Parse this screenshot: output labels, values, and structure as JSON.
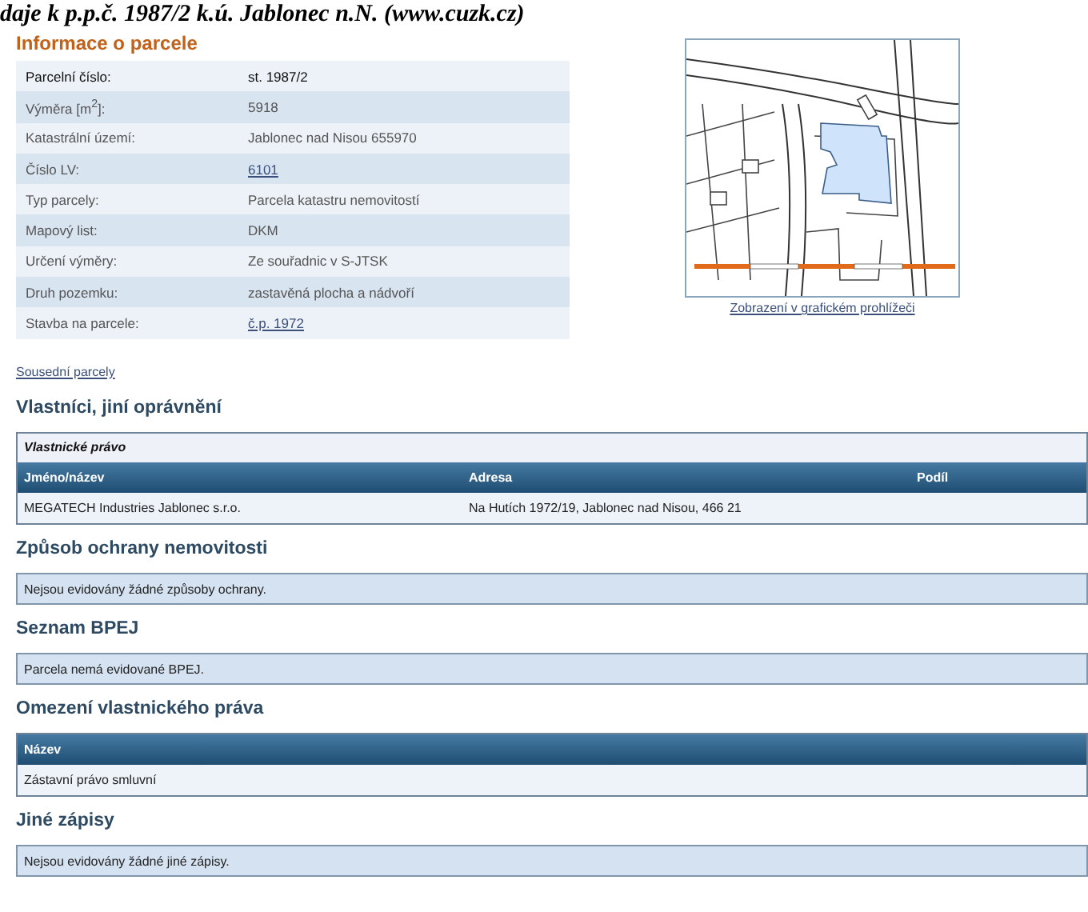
{
  "caption": "daje k p.p.č. 1987/2 k.ú. Jablonec n.N. (www.cuzk.cz)",
  "info": {
    "title": "Informace o parcele",
    "rows": [
      {
        "label": "Parcelní číslo:",
        "value": "st. 1987/2",
        "kind": "bold"
      },
      {
        "label": "Výměra [m$^{2}$]:",
        "value": "5918",
        "kind": "text"
      },
      {
        "label": "Katastrální území:",
        "value": "Jablonec nad Nisou 655970",
        "kind": "text"
      },
      {
        "label": "Číslo LV:",
        "value": "6101",
        "kind": "link"
      },
      {
        "label": "Typ parcely:",
        "value": "Parcela katastru nemovitostí",
        "kind": "text"
      },
      {
        "label": "Mapový list:",
        "value": "DKM",
        "kind": "text"
      },
      {
        "label": "Určení výměry:",
        "value": "Ze souřadnic v S-JTSK",
        "kind": "text"
      },
      {
        "label": "Druh pozemku:",
        "value": "zastavěná plocha a nádvoří",
        "kind": "text"
      },
      {
        "label": "Stavba na parcele:",
        "value": "č.p. 1972",
        "kind": "link"
      }
    ]
  },
  "map": {
    "kind": "picture",
    "link": "Zobrazení v grafickém prohlížeči"
  },
  "neighbors_link": "Sousední parcely",
  "sections": [
    {
      "title": "Vlastníci, jiní oprávnění",
      "kind": "table",
      "caption": "Vlastnické právo",
      "columns": [
        "Jméno/název",
        "Adresa",
        "Podíl"
      ],
      "rows": [
        [
          "MEGATECH Industries Jablonec s.r.o.",
          "Na Hutích 1972/19, Jablonec nad Nisou, 466 21"
        ]
      ]
    },
    {
      "title": "Způsob ochrany nemovitosti",
      "kind": "note",
      "text": "Nejsou evidovány žádné způsoby ochrany."
    },
    {
      "title": "Seznam BPEJ",
      "kind": "note",
      "text": "Parcela nemá evidované BPEJ."
    },
    {
      "title": "Omezení vlastnického práva",
      "kind": "table",
      "columns": [
        "Název"
      ],
      "rows": [
        [
          "Zástavní právo smluvní"
        ]
      ]
    },
    {
      "title": "Jiné zápisy",
      "kind": "note",
      "text": "Nejsou evidovány žádné jiné zápisy."
    }
  ]
}
